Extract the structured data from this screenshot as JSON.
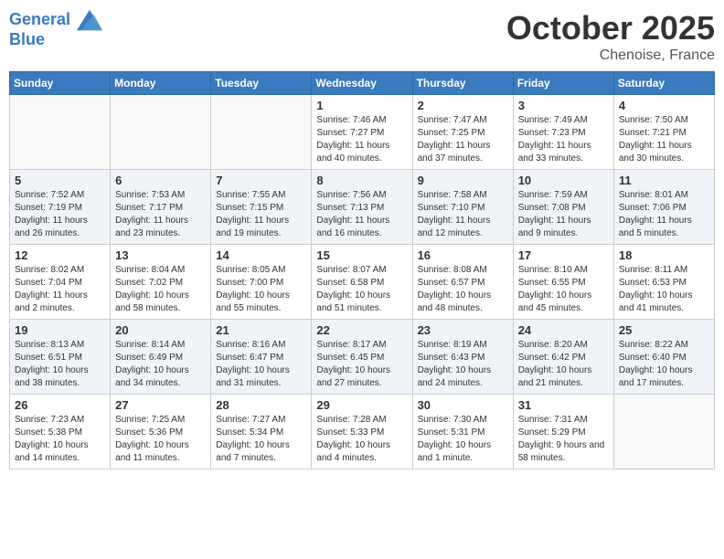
{
  "header": {
    "logo_line1": "General",
    "logo_line2": "Blue",
    "month_title": "October 2025",
    "location": "Chenoise, France"
  },
  "calendar": {
    "days_of_week": [
      "Sunday",
      "Monday",
      "Tuesday",
      "Wednesday",
      "Thursday",
      "Friday",
      "Saturday"
    ],
    "weeks": [
      [
        {
          "day": "",
          "info": ""
        },
        {
          "day": "",
          "info": ""
        },
        {
          "day": "",
          "info": ""
        },
        {
          "day": "1",
          "info": "Sunrise: 7:46 AM\nSunset: 7:27 PM\nDaylight: 11 hours and 40 minutes."
        },
        {
          "day": "2",
          "info": "Sunrise: 7:47 AM\nSunset: 7:25 PM\nDaylight: 11 hours and 37 minutes."
        },
        {
          "day": "3",
          "info": "Sunrise: 7:49 AM\nSunset: 7:23 PM\nDaylight: 11 hours and 33 minutes."
        },
        {
          "day": "4",
          "info": "Sunrise: 7:50 AM\nSunset: 7:21 PM\nDaylight: 11 hours and 30 minutes."
        }
      ],
      [
        {
          "day": "5",
          "info": "Sunrise: 7:52 AM\nSunset: 7:19 PM\nDaylight: 11 hours and 26 minutes."
        },
        {
          "day": "6",
          "info": "Sunrise: 7:53 AM\nSunset: 7:17 PM\nDaylight: 11 hours and 23 minutes."
        },
        {
          "day": "7",
          "info": "Sunrise: 7:55 AM\nSunset: 7:15 PM\nDaylight: 11 hours and 19 minutes."
        },
        {
          "day": "8",
          "info": "Sunrise: 7:56 AM\nSunset: 7:13 PM\nDaylight: 11 hours and 16 minutes."
        },
        {
          "day": "9",
          "info": "Sunrise: 7:58 AM\nSunset: 7:10 PM\nDaylight: 11 hours and 12 minutes."
        },
        {
          "day": "10",
          "info": "Sunrise: 7:59 AM\nSunset: 7:08 PM\nDaylight: 11 hours and 9 minutes."
        },
        {
          "day": "11",
          "info": "Sunrise: 8:01 AM\nSunset: 7:06 PM\nDaylight: 11 hours and 5 minutes."
        }
      ],
      [
        {
          "day": "12",
          "info": "Sunrise: 8:02 AM\nSunset: 7:04 PM\nDaylight: 11 hours and 2 minutes."
        },
        {
          "day": "13",
          "info": "Sunrise: 8:04 AM\nSunset: 7:02 PM\nDaylight: 10 hours and 58 minutes."
        },
        {
          "day": "14",
          "info": "Sunrise: 8:05 AM\nSunset: 7:00 PM\nDaylight: 10 hours and 55 minutes."
        },
        {
          "day": "15",
          "info": "Sunrise: 8:07 AM\nSunset: 6:58 PM\nDaylight: 10 hours and 51 minutes."
        },
        {
          "day": "16",
          "info": "Sunrise: 8:08 AM\nSunset: 6:57 PM\nDaylight: 10 hours and 48 minutes."
        },
        {
          "day": "17",
          "info": "Sunrise: 8:10 AM\nSunset: 6:55 PM\nDaylight: 10 hours and 45 minutes."
        },
        {
          "day": "18",
          "info": "Sunrise: 8:11 AM\nSunset: 6:53 PM\nDaylight: 10 hours and 41 minutes."
        }
      ],
      [
        {
          "day": "19",
          "info": "Sunrise: 8:13 AM\nSunset: 6:51 PM\nDaylight: 10 hours and 38 minutes."
        },
        {
          "day": "20",
          "info": "Sunrise: 8:14 AM\nSunset: 6:49 PM\nDaylight: 10 hours and 34 minutes."
        },
        {
          "day": "21",
          "info": "Sunrise: 8:16 AM\nSunset: 6:47 PM\nDaylight: 10 hours and 31 minutes."
        },
        {
          "day": "22",
          "info": "Sunrise: 8:17 AM\nSunset: 6:45 PM\nDaylight: 10 hours and 27 minutes."
        },
        {
          "day": "23",
          "info": "Sunrise: 8:19 AM\nSunset: 6:43 PM\nDaylight: 10 hours and 24 minutes."
        },
        {
          "day": "24",
          "info": "Sunrise: 8:20 AM\nSunset: 6:42 PM\nDaylight: 10 hours and 21 minutes."
        },
        {
          "day": "25",
          "info": "Sunrise: 8:22 AM\nSunset: 6:40 PM\nDaylight: 10 hours and 17 minutes."
        }
      ],
      [
        {
          "day": "26",
          "info": "Sunrise: 7:23 AM\nSunset: 5:38 PM\nDaylight: 10 hours and 14 minutes."
        },
        {
          "day": "27",
          "info": "Sunrise: 7:25 AM\nSunset: 5:36 PM\nDaylight: 10 hours and 11 minutes."
        },
        {
          "day": "28",
          "info": "Sunrise: 7:27 AM\nSunset: 5:34 PM\nDaylight: 10 hours and 7 minutes."
        },
        {
          "day": "29",
          "info": "Sunrise: 7:28 AM\nSunset: 5:33 PM\nDaylight: 10 hours and 4 minutes."
        },
        {
          "day": "30",
          "info": "Sunrise: 7:30 AM\nSunset: 5:31 PM\nDaylight: 10 hours and 1 minute."
        },
        {
          "day": "31",
          "info": "Sunrise: 7:31 AM\nSunset: 5:29 PM\nDaylight: 9 hours and 58 minutes."
        },
        {
          "day": "",
          "info": ""
        }
      ]
    ]
  }
}
